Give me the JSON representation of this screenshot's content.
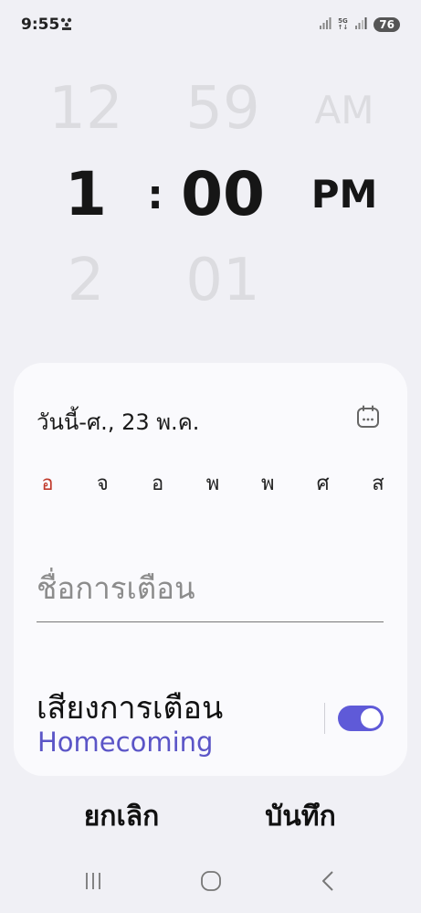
{
  "status_bar": {
    "time": "9:55",
    "network": "5G",
    "battery": "76",
    "icons": [
      "notification-dots-icon",
      "signal-icon",
      "network-5g-icon",
      "signal-icon",
      "battery-icon"
    ]
  },
  "picker": {
    "hour_prev": "12",
    "hour": "1",
    "hour_next": "2",
    "separator": ":",
    "minute_prev": "59",
    "minute": "00",
    "minute_next": "01",
    "ampm_prev": "AM",
    "ampm": "PM"
  },
  "card": {
    "date_label": "วันนี้-ศ., 23 พ.ค.",
    "calendar_icon": "calendar-icon",
    "days": [
      {
        "label": "อ",
        "highlight": true
      },
      {
        "label": "จ",
        "highlight": false
      },
      {
        "label": "อ",
        "highlight": false
      },
      {
        "label": "พ",
        "highlight": false
      },
      {
        "label": "พ",
        "highlight": false
      },
      {
        "label": "ศ",
        "highlight": false
      },
      {
        "label": "ส",
        "highlight": false
      }
    ],
    "name_placeholder": "ชื่อการเตือน",
    "name_value": "",
    "sound_title": "เสียงการเตือน",
    "sound_value": "Homecoming",
    "sound_enabled": true
  },
  "actions": {
    "cancel": "ยกเลิก",
    "save": "บันทึก"
  },
  "navbar": {
    "icons": [
      "recent-apps-icon",
      "home-icon",
      "back-icon"
    ]
  },
  "colors": {
    "accent": "#5f5ad8",
    "sound_value": "#5b55c7",
    "sunday": "#c0392b",
    "background": "#f0f0f5"
  }
}
